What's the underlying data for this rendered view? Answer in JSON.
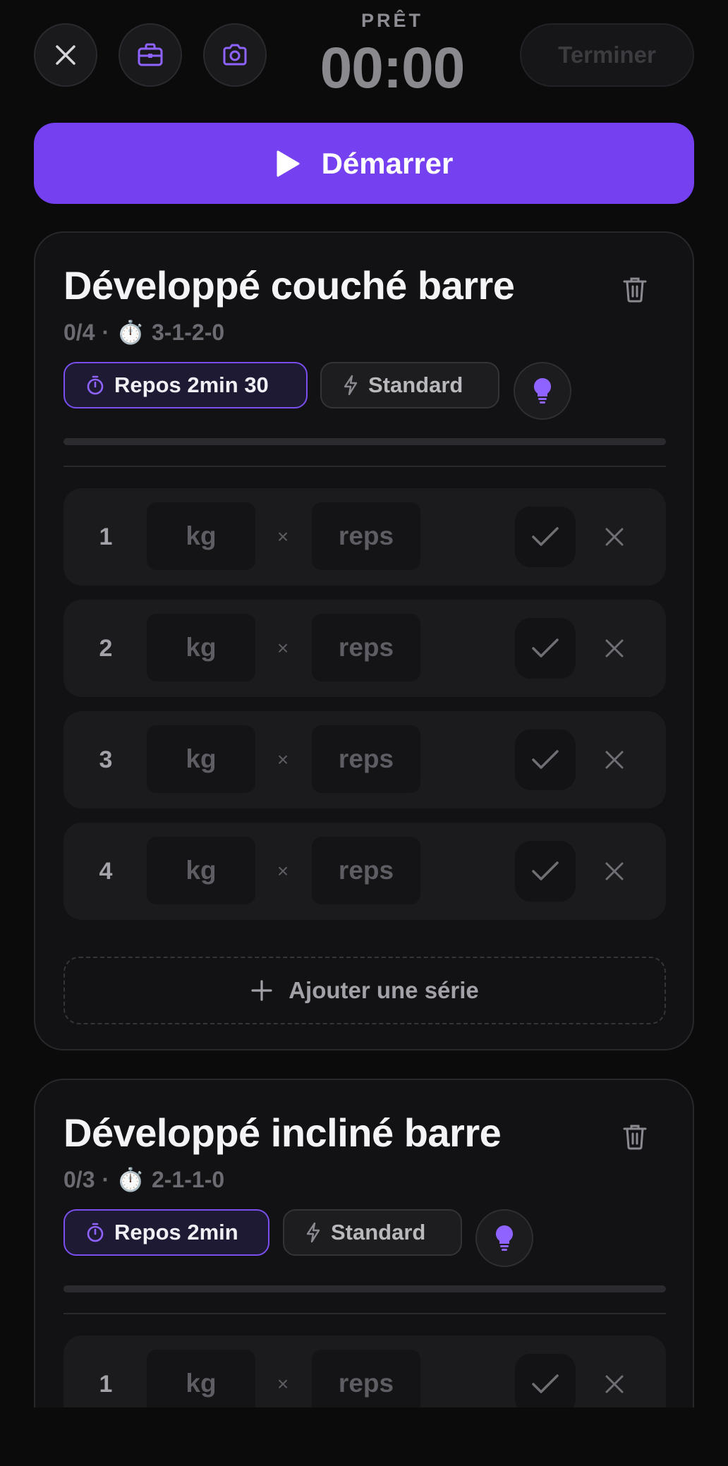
{
  "header": {
    "status": "PRÊT",
    "timer": "00:00",
    "finish_label": "Terminer",
    "close_icon": "close-icon",
    "toolbox_icon": "briefcase-icon",
    "camera_icon": "camera-icon"
  },
  "start_button": {
    "label": "Démarrer",
    "icon": "play-icon"
  },
  "colors": {
    "accent": "#7440f0",
    "background": "#0b0b0c",
    "card": "#121214"
  },
  "exercises": [
    {
      "title": "Développé couché barre",
      "meta_progress": "0/4",
      "meta_separator": "·",
      "meta_emoji": "⏱️",
      "tempo": "3-1-2-0",
      "rest_label": "Repos 2min 30",
      "mode_label": "Standard",
      "tip_icon": "lightbulb-icon",
      "sets": [
        {
          "number": "1",
          "kg_placeholder": "kg",
          "times": "×",
          "reps_placeholder": "reps"
        },
        {
          "number": "2",
          "kg_placeholder": "kg",
          "times": "×",
          "reps_placeholder": "reps"
        },
        {
          "number": "3",
          "kg_placeholder": "kg",
          "times": "×",
          "reps_placeholder": "reps"
        },
        {
          "number": "4",
          "kg_placeholder": "kg",
          "times": "×",
          "reps_placeholder": "reps"
        }
      ],
      "add_set_label": "Ajouter une série"
    },
    {
      "title": "Développé incliné barre",
      "meta_progress": "0/3",
      "meta_separator": "·",
      "meta_emoji": "⏱️",
      "tempo": "2-1-1-0",
      "rest_label": "Repos 2min",
      "mode_label": "Standard",
      "tip_icon": "lightbulb-icon",
      "sets": [
        {
          "number": "1",
          "kg_placeholder": "kg",
          "times": "×",
          "reps_placeholder": "reps"
        }
      ]
    }
  ]
}
